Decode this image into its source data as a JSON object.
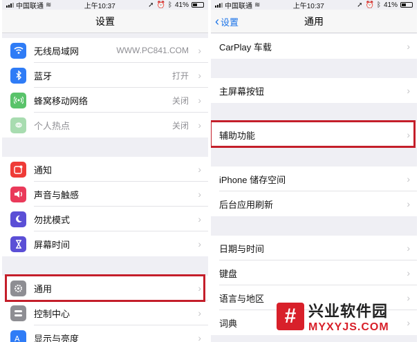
{
  "left_screen": {
    "status": {
      "carrier": "中国联通",
      "time": "上午10:37",
      "battery": "41%"
    },
    "nav_title": "设置",
    "rows": [
      {
        "label": "无线局域网",
        "value": "WWW.PC841.COM",
        "icon": "wifi-icon",
        "color": "#2f7cf6"
      },
      {
        "label": "蓝牙",
        "value": "打开",
        "icon": "bluetooth-icon",
        "color": "#2f7cf6"
      },
      {
        "label": "蜂窝移动网络",
        "value": "关闭",
        "icon": "cellular-icon",
        "color": "#59c36a"
      },
      {
        "label": "个人热点",
        "value": "关闭",
        "icon": "hotspot-icon",
        "color": "#a8dcb0"
      },
      {
        "label": "通知",
        "value": "",
        "icon": "notification-icon",
        "color": "#ef3b37"
      },
      {
        "label": "声音与触感",
        "value": "",
        "icon": "sound-icon",
        "color": "#ea3a5a"
      },
      {
        "label": "勿扰模式",
        "value": "",
        "icon": "moon-icon",
        "color": "#5b4fd6"
      },
      {
        "label": "屏幕时间",
        "value": "",
        "icon": "hourglass-icon",
        "color": "#5b4fd6"
      },
      {
        "label": "通用",
        "value": "",
        "icon": "gear-icon",
        "color": "#8e8e93"
      },
      {
        "label": "控制中心",
        "value": "",
        "icon": "control-center-icon",
        "color": "#8e8e93"
      },
      {
        "label": "显示与亮度",
        "value": "",
        "icon": "display-icon",
        "color": "#2f7cf6"
      }
    ]
  },
  "right_screen": {
    "status": {
      "carrier": "中国联通",
      "time": "上午10:37",
      "battery": "41%"
    },
    "back_label": "设置",
    "nav_title": "通用",
    "rows": [
      {
        "label": "CarPlay 车载"
      },
      {
        "label": "主屏幕按钮"
      },
      {
        "label": "辅助功能"
      },
      {
        "label": "iPhone 储存空间"
      },
      {
        "label": "后台应用刷新"
      },
      {
        "label": "日期与时间"
      },
      {
        "label": "键盘"
      },
      {
        "label": "语言与地区"
      },
      {
        "label": "词典"
      }
    ]
  },
  "watermark": {
    "logo_glyph": "#",
    "cn": "兴业软件园",
    "en": "MYXYJS.COM"
  },
  "colors": {
    "highlight": "#c41e2a",
    "accent": "#1a73e8"
  }
}
